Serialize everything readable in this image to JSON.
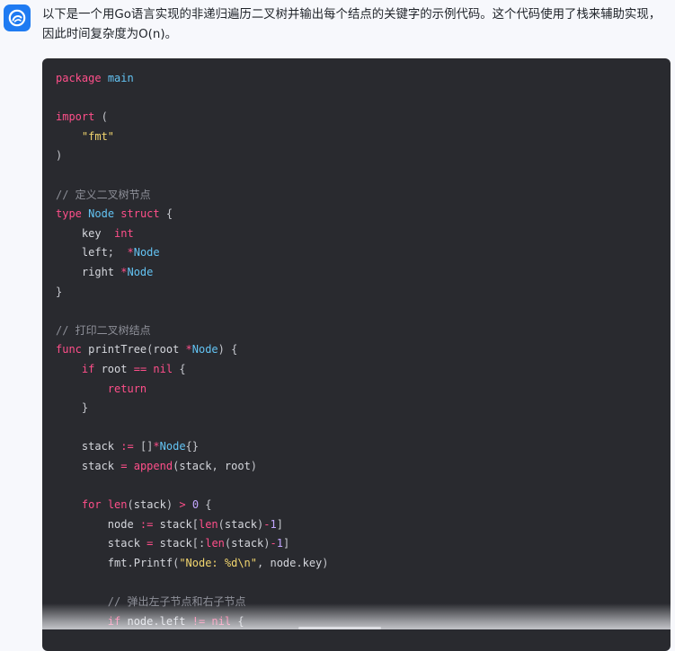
{
  "message": {
    "avatar_icon": "bot-logo-icon",
    "intro_text": "以下是一个用Go语言实现的非递归遍历二叉树并输出每个结点的关键字的示例代码。这个代码使用了栈来辅助实现，因此时间复杂度为O(n)。"
  },
  "code": {
    "language": "go",
    "lines": [
      "package main",
      "",
      "import (",
      "    \"fmt\"",
      ")",
      "",
      "// 定义二叉树节点",
      "type Node struct {",
      "    key  int",
      "    left;  *Node",
      "    right *Node",
      "}",
      "",
      "// 打印二叉树结点",
      "func printTree(root *Node) {",
      "    if root == nil {",
      "        return",
      "    }",
      "",
      "    stack := []*Node{}",
      "    stack = append(stack, root)",
      "",
      "    for len(stack) > 0 {",
      "        node := stack[len(stack)-1]",
      "        stack = stack[:len(stack)-1]",
      "        fmt.Printf(\"Node: %d\\n\", node.key)",
      "",
      "        // 弹出左子节点和右子节点",
      "        if node.left != nil {"
    ]
  },
  "colors": {
    "keyword": "#ff4f8a",
    "type": "#63c3f3",
    "string": "#f2d56e",
    "comment": "#8e9099",
    "code_background": "#292a2f",
    "page_background": "#f7f8fc",
    "avatar_background": "#1f7bf2"
  }
}
